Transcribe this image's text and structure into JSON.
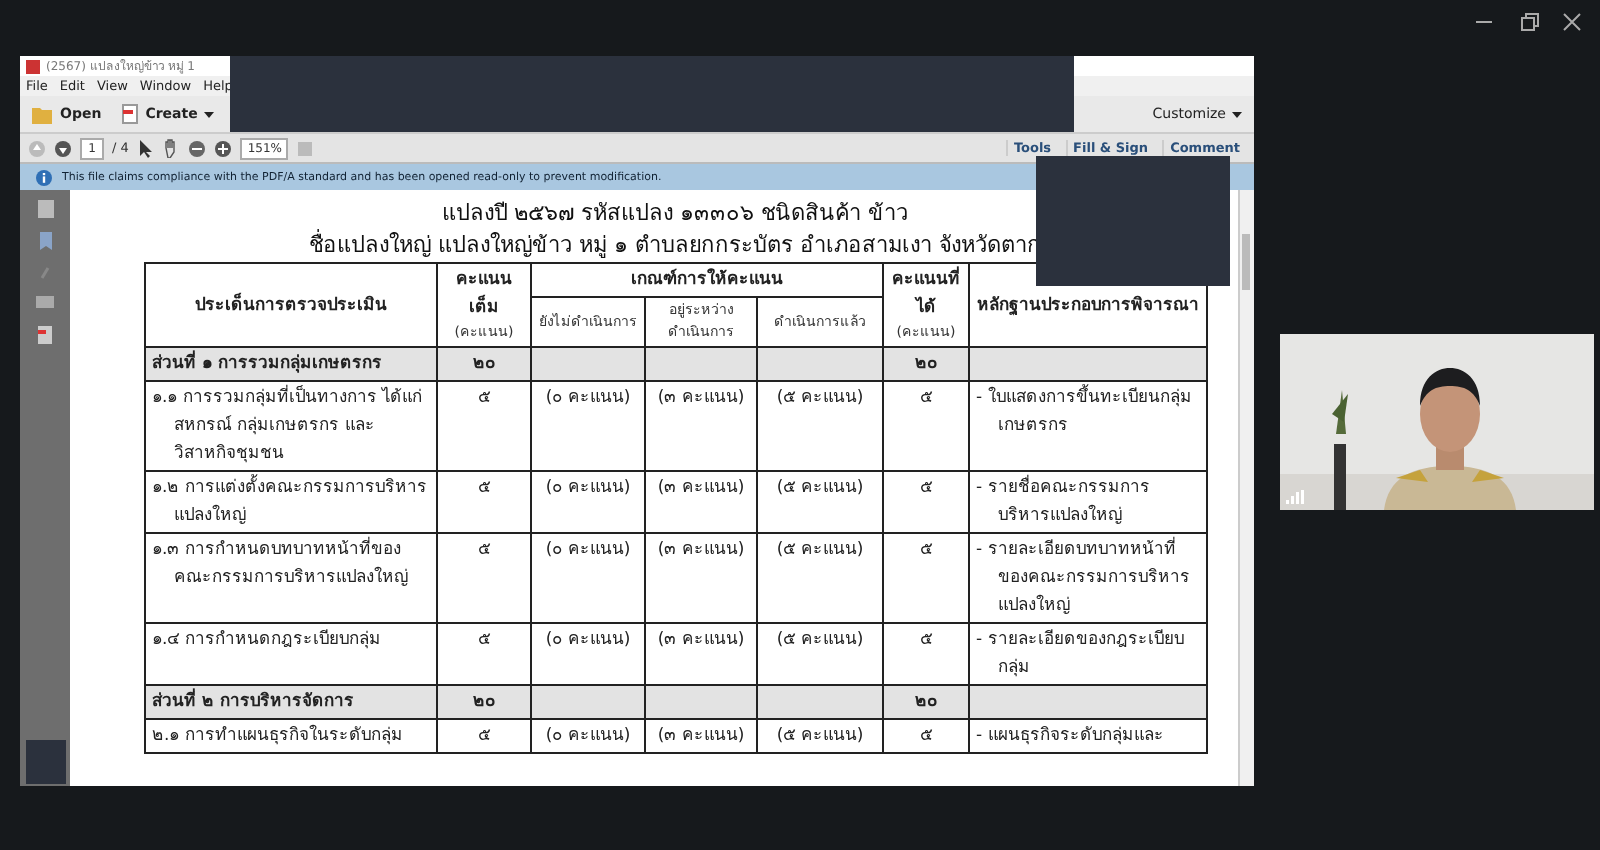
{
  "window": {
    "title": "(2567) แปลงใหญ่ข้าว หมู่ 1"
  },
  "menu": [
    "File",
    "Edit",
    "View",
    "Window",
    "Help"
  ],
  "toolbar": {
    "open": "Open",
    "create": "Create",
    "customize": "Customize"
  },
  "nav": {
    "page": "1",
    "of": "/ 4",
    "zoom": "151%",
    "panels": [
      "Tools",
      "Fill & Sign",
      "Comment"
    ]
  },
  "info_bar": "This file claims compliance with the PDF/A standard and has been opened read-only to prevent modification.",
  "document": {
    "lines": [
      "แปลงปี  ๒๕๖๗  รหัสแปลง  ๑๓๓๐๖  ชนิดสินค้า ข้าว",
      "ชื่อแปลงใหญ่ แปลงใหญ่ข้าว หมู่ ๑ ตำบลยกกระบัตร อำเภอสามเงา จังหวัดตาก"
    ],
    "header": {
      "issue": "ประเด็นการตรวจประเมิน",
      "full": "คะแนนเต็ม",
      "full_unit": "(คะแนน)",
      "criteria": "เกณฑ์การให้คะแนน",
      "criteria_cols": [
        "ยังไม่ดำเนินการ",
        "อยู่ระหว่างดำเนินการ",
        "ดำเนินการแล้ว"
      ],
      "got": "คะแนนที่ได้",
      "got_unit": "(คะแนน)",
      "evidence": "หลักฐานประกอบการพิจารณา"
    },
    "rows": [
      {
        "kind": "section",
        "issue": "ส่วนที่ ๑  การรวมกลุ่มเกษตรกร",
        "full": "๒๐",
        "got": "๒๐"
      },
      {
        "kind": "item",
        "issue": "๑.๑ การรวมกลุ่มที่เป็นทางการ ได้แก่ สหกรณ์ กลุ่มเกษตรกร และ วิสาหกิจชุมชน",
        "full": "๕",
        "criteria": [
          "(๐ คะแนน)",
          "(๓ คะแนน)",
          "(๕ คะแนน)"
        ],
        "got": "๕",
        "evidence": "- ใบแสดงการขึ้นทะเบียนกลุ่มเกษตรกร"
      },
      {
        "kind": "item",
        "issue": "๑.๒ การแต่งตั้งคณะกรรมการบริหารแปลงใหญ่",
        "full": "๕",
        "criteria": [
          "(๐ คะแนน)",
          "(๓ คะแนน)",
          "(๕ คะแนน)"
        ],
        "got": "๕",
        "evidence": "- รายชื่อคณะกรรมการบริหารแปลงใหญ่"
      },
      {
        "kind": "item",
        "issue": "๑.๓ การกำหนดบทบาทหน้าที่ของคณะกรรมการบริหารแปลงใหญ่",
        "full": "๕",
        "criteria": [
          "(๐ คะแนน)",
          "(๓ คะแนน)",
          "(๕ คะแนน)"
        ],
        "got": "๕",
        "evidence": "- รายละเอียดบทบาทหน้าที่ของคณะกรรมการบริหารแปลงใหญ่"
      },
      {
        "kind": "item",
        "issue": "๑.๔ การกำหนดกฎระเบียบกลุ่ม",
        "full": "๕",
        "criteria": [
          "(๐ คะแนน)",
          "(๓ คะแนน)",
          "(๕ คะแนน)"
        ],
        "got": "๕",
        "evidence": "- รายละเอียดของกฎระเบียบกลุ่ม"
      },
      {
        "kind": "section",
        "issue": "ส่วนที่ ๒  การบริหารจัดการ",
        "full": "๒๐",
        "got": "๒๐"
      },
      {
        "kind": "item",
        "issue": "๒.๑ การทำแผนธุรกิจในระดับกลุ่ม",
        "full": "๕",
        "criteria": [
          "(๐ คะแนน)",
          "(๓ คะแนน)",
          "(๕ คะแนน)"
        ],
        "got": "๕",
        "evidence": "- แผนธุรกิจระดับกลุ่มและ"
      }
    ]
  }
}
